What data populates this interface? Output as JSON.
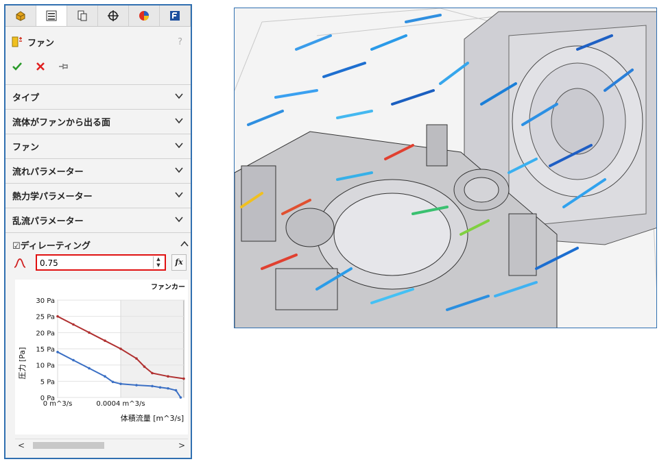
{
  "tabs": [
    {
      "icon": "feature-manager-icon",
      "active": false
    },
    {
      "icon": "property-manager-icon",
      "active": true
    },
    {
      "icon": "configuration-manager-icon",
      "active": false
    },
    {
      "icon": "dimxpert-manager-icon",
      "active": false
    },
    {
      "icon": "display-manager-icon",
      "active": false
    },
    {
      "icon": "flow-simulation-icon",
      "active": false
    }
  ],
  "property": {
    "title": "ファン",
    "help": "?",
    "ok_icon": "checkmark-icon",
    "cancel_icon": "x-icon",
    "pin_icon": "pushpin-icon"
  },
  "sections": [
    {
      "label": "タイプ"
    },
    {
      "label": "流体がファンから出る面"
    },
    {
      "label": "ファン"
    },
    {
      "label": "流れパラメーター"
    },
    {
      "label": "熱力学パラメーター"
    },
    {
      "label": "乱流パラメーター"
    }
  ],
  "derating": {
    "label": "☑ディレーティング",
    "value": "0.75",
    "fx_label": "fx"
  },
  "colors": {
    "accent_border": "#2f6fb0",
    "highlight_border": "#e01010",
    "curve_red": "#b03030",
    "curve_blue": "#3a6fc4"
  },
  "chart_data": {
    "type": "line",
    "title": "ファンカー",
    "xlabel": "体積流量 [m^3/s]",
    "ylabel": "圧力 [Pa]",
    "x_ticks": [
      "0 m^3/s",
      "0.0004 m^3/s"
    ],
    "y_ticks": [
      "0 Pa",
      "5 Pa",
      "10 Pa",
      "15 Pa",
      "20 Pa",
      "25 Pa",
      "30 Pa"
    ],
    "xlim": [
      0,
      0.0008
    ],
    "ylim": [
      0,
      30
    ],
    "series": [
      {
        "color": "#b03030",
        "x": [
          0,
          0.0001,
          0.0002,
          0.0003,
          0.0004,
          0.0005,
          0.00055,
          0.0006,
          0.0007,
          0.0008
        ],
        "y": [
          25,
          22.5,
          20,
          17.5,
          15,
          12,
          9.5,
          7.5,
          6.5,
          5.8
        ]
      },
      {
        "color": "#3a6fc4",
        "x": [
          0,
          0.0001,
          0.0002,
          0.0003,
          0.00035,
          0.0004,
          0.0005,
          0.0006,
          0.00065,
          0.0007,
          0.00075,
          0.00078
        ],
        "y": [
          14,
          11.5,
          9,
          6.5,
          4.8,
          4.2,
          3.8,
          3.5,
          3.1,
          2.8,
          2.2,
          0
        ]
      }
    ]
  },
  "scrollbar": {
    "left": "<",
    "right": ">"
  }
}
